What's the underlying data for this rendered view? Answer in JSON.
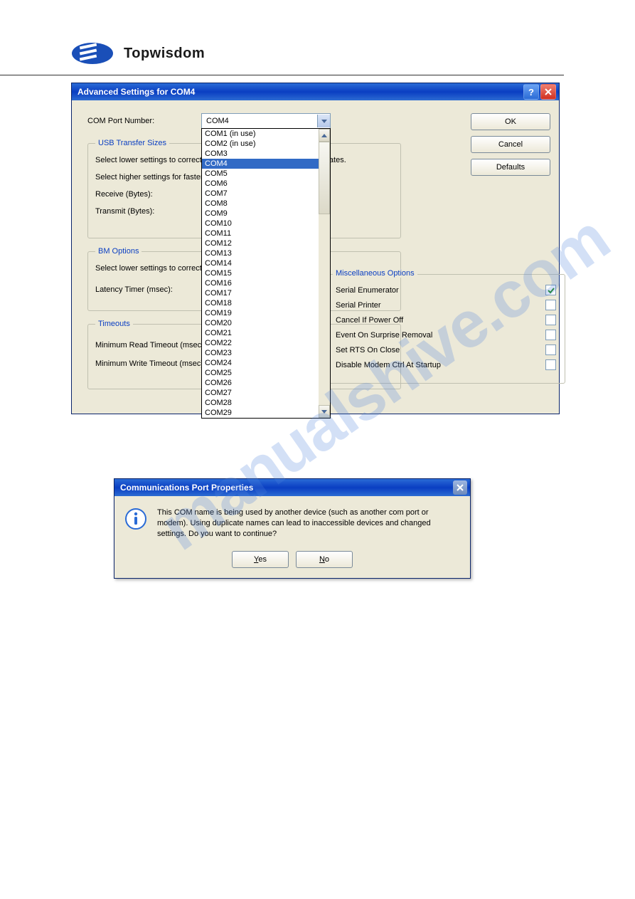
{
  "brand": "Topwisdom",
  "watermark": "manualshive.com",
  "window1": {
    "title": "Advanced Settings for COM4",
    "comport_label": "COM Port Number:",
    "comport_value": "COM4",
    "buttons": {
      "ok": "OK",
      "cancel": "Cancel",
      "defaults": "Defaults"
    },
    "usb_group": {
      "legend": "USB Transfer Sizes",
      "line1": "Select lower settings to correct performance problems at low baud rates.",
      "line2": "Select higher settings for faster performance.",
      "receive": "Receive (Bytes):",
      "transmit": "Transmit (Bytes):"
    },
    "bm_group": {
      "legend": "BM Options",
      "line1": "Select lower settings to correct response problems.",
      "latency": "Latency Timer (msec):"
    },
    "timeouts_group": {
      "legend": "Timeouts",
      "min_read": "Minimum Read Timeout (msec):",
      "min_write": "Minimum Write Timeout (msec):"
    },
    "misc_group": {
      "legend": "Miscellaneous Options",
      "items": [
        {
          "label": "Serial Enumerator",
          "checked": true
        },
        {
          "label": "Serial Printer",
          "checked": false
        },
        {
          "label": "Cancel If Power Off",
          "checked": false
        },
        {
          "label": "Event On Surprise Removal",
          "checked": false
        },
        {
          "label": "Set RTS On Close",
          "checked": false
        },
        {
          "label": "Disable Modem Ctrl At Startup",
          "checked": false
        }
      ]
    },
    "dropdown": {
      "selected": "COM4",
      "items": [
        "COM1 (in use)",
        "COM2 (in use)",
        "COM3",
        "COM4",
        "COM5",
        "COM6",
        "COM7",
        "COM8",
        "COM9",
        "COM10",
        "COM11",
        "COM12",
        "COM13",
        "COM14",
        "COM15",
        "COM16",
        "COM17",
        "COM18",
        "COM19",
        "COM20",
        "COM21",
        "COM22",
        "COM23",
        "COM24",
        "COM25",
        "COM26",
        "COM27",
        "COM28",
        "COM29"
      ]
    }
  },
  "window2": {
    "title": "Communications Port Properties",
    "message": "This COM name is being used by another device (such as another com port or modem). Using duplicate names can lead to inaccessible devices and changed settings.  Do you want to continue?",
    "yes": "Yes",
    "no": "No"
  }
}
